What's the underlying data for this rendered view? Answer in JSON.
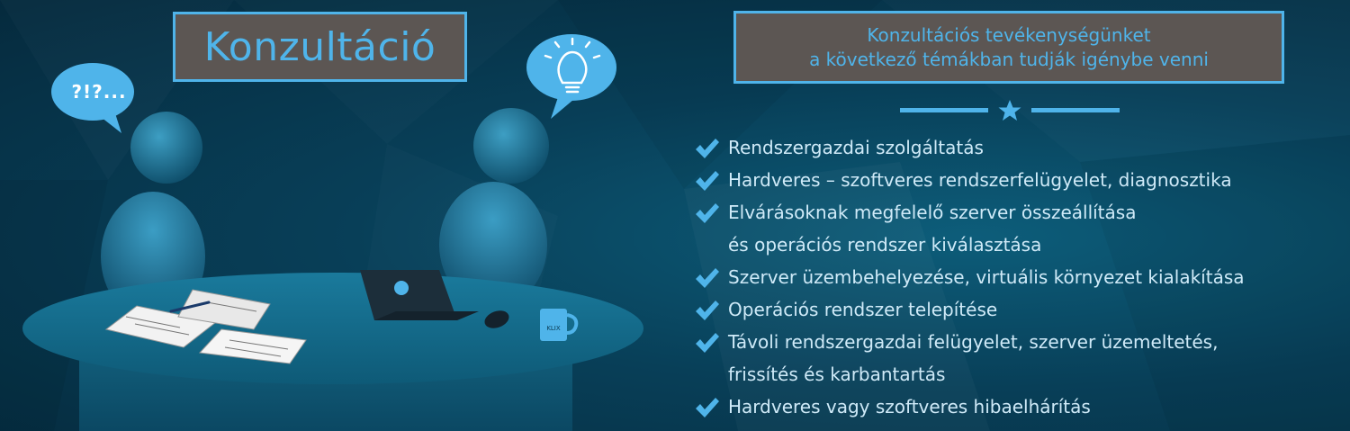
{
  "banner": {
    "title": "Konzultáció",
    "question_bubble_text": "?!?...",
    "mug_label": "KLIX",
    "intro_line1": "Konzultációs tevékenységünket",
    "intro_line2": "a következő témákban tudják igénybe venni",
    "services": [
      {
        "line1": "Rendszergazdai szolgáltatás"
      },
      {
        "line1": "Hardveres – szoftveres rendszerfelügyelet, diagnosztika"
      },
      {
        "line1": "Elvárásoknak megfelelő szerver összeállítása",
        "line2": "és operációs rendszer kiválasztása"
      },
      {
        "line1": "Szerver üzembehelyezése, virtuális környezet kialakítása"
      },
      {
        "line1": "Operációs rendszer telepítése"
      },
      {
        "line1": "Távoli rendszergazdai felügyelet, szerver üzemeltetés,",
        "line2": "frissítés és karbantartás"
      },
      {
        "line1": "Hardveres vagy szoftveres hibaelhárítás"
      }
    ],
    "colors": {
      "accent": "#4fb4ea",
      "box_fill": "#5c5653",
      "text_light": "#cfeaf8",
      "background": "#083f58"
    },
    "icons": [
      "speech-bubble-icon",
      "lightbulb-icon",
      "star-icon",
      "checkmark-icon",
      "laptop-icon",
      "mouse-icon",
      "mug-icon"
    ]
  }
}
